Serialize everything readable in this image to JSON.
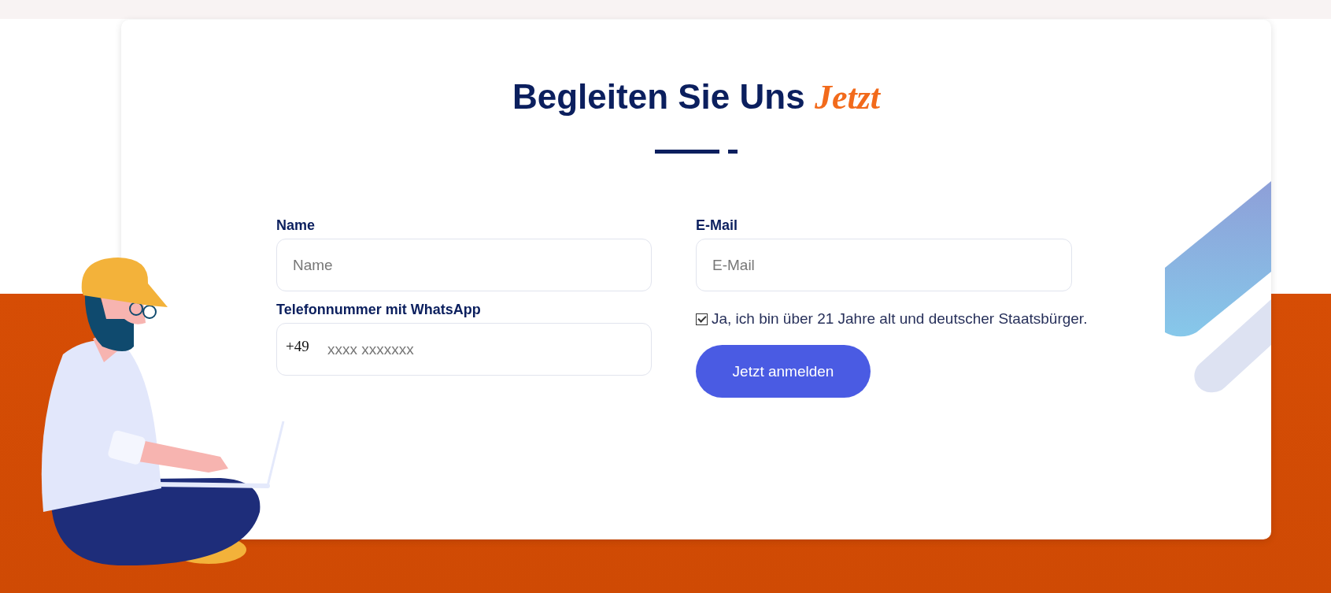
{
  "heading": {
    "text": "Begleiten Sie Uns",
    "accent": "Jetzt"
  },
  "fields": [
    {
      "kind": "text",
      "label": "Name",
      "placeholder": "Name"
    },
    {
      "kind": "text",
      "label": "E-Mail",
      "placeholder": "E-Mail"
    },
    {
      "kind": "phone",
      "label": "Telefonnummer mit WhatsApp",
      "prefix": "+49",
      "placeholder": "xxxx xxxxxxx"
    }
  ],
  "consent": {
    "text": "Ja, ich bin über 21 Jahre alt und deutscher Staatsbürger.",
    "checked": true
  },
  "submit": "Jetzt anmelden"
}
